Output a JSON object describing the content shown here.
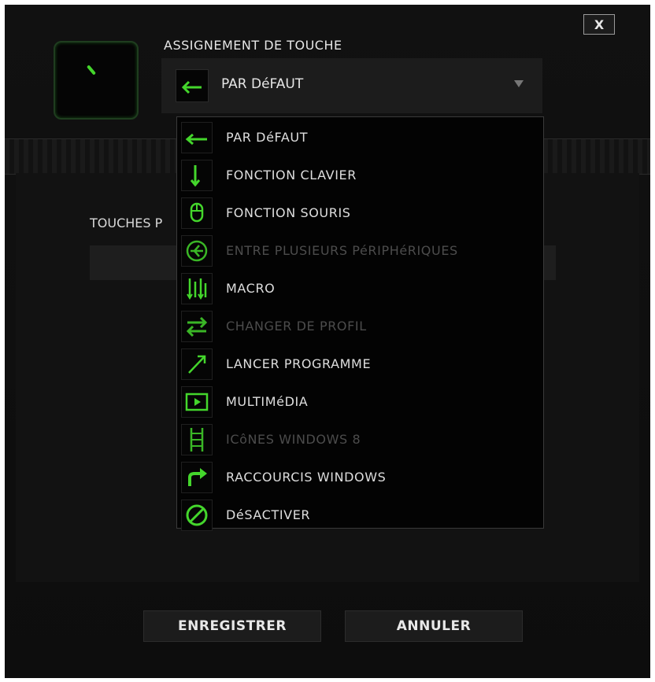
{
  "dialog": {
    "close_label": "X",
    "title": "ASSIGNEMENT DE TOUCHE",
    "selected": "PAR DéFAUT",
    "touches_label": "TOUCHES P"
  },
  "colors": {
    "accent": "#44d62c",
    "background": "#0c0c0c",
    "disabled_text": "#4c4c4c"
  },
  "options": [
    {
      "label": "PAR DéFAUT",
      "icon": "default-arrow-icon",
      "enabled": true
    },
    {
      "label": "FONCTION CLAVIER",
      "icon": "keyboard-function-icon",
      "enabled": true
    },
    {
      "label": "FONCTION SOURIS",
      "icon": "mouse-icon",
      "enabled": true
    },
    {
      "label": "ENTRE PLUSIEURS PéRIPHéRIQUES",
      "icon": "inter-device-icon",
      "enabled": false
    },
    {
      "label": "MACRO",
      "icon": "macro-icon",
      "enabled": true
    },
    {
      "label": "CHANGER DE PROFIL",
      "icon": "switch-profile-icon",
      "enabled": false
    },
    {
      "label": "LANCER PROGRAMME",
      "icon": "launch-program-icon",
      "enabled": true
    },
    {
      "label": "MULTIMéDIA",
      "icon": "multimedia-icon",
      "enabled": true
    },
    {
      "label": "ICôNES WINDOWS 8",
      "icon": "windows8-charms-icon",
      "enabled": false
    },
    {
      "label": "RACCOURCIS WINDOWS",
      "icon": "windows-shortcut-icon",
      "enabled": true
    },
    {
      "label": "DéSACTIVER",
      "icon": "disable-icon",
      "enabled": true
    }
  ],
  "buttons": {
    "save": "ENREGISTRER",
    "cancel": "ANNULER"
  }
}
